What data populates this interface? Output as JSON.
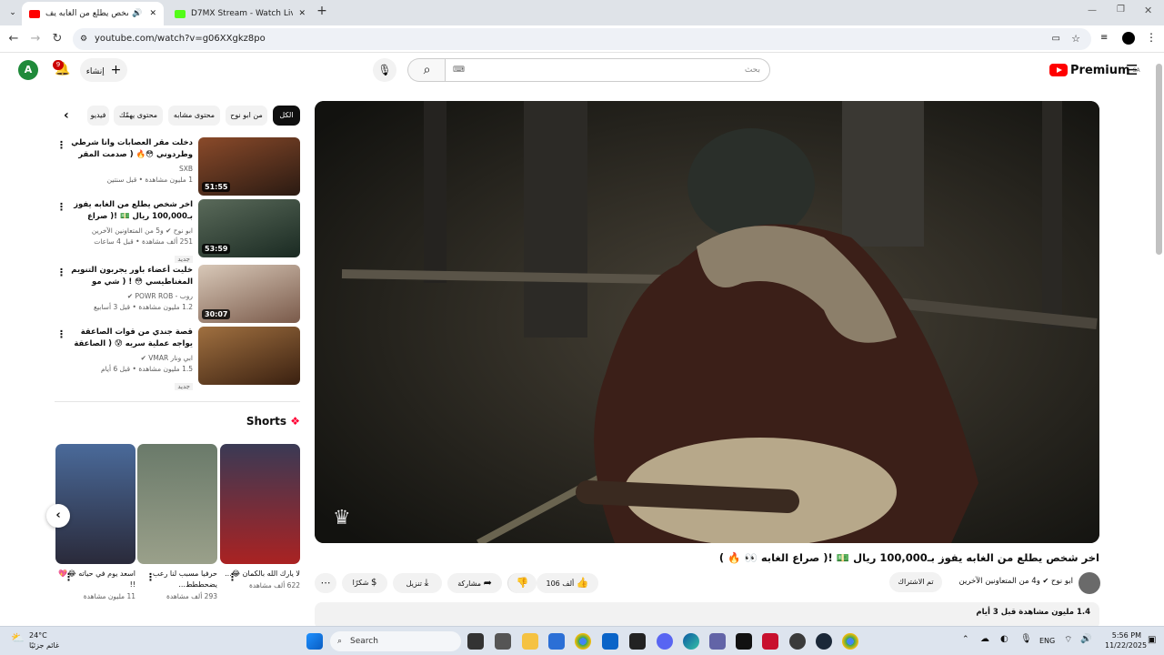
{
  "browser": {
    "tabs": [
      {
        "title": "اخر شخص يطلع من الغابه يف",
        "active": true,
        "favicon_color": "#ff0000"
      },
      {
        "title": "D7MX Stream - Watch Live on",
        "active": false,
        "favicon_color": "#53fc18"
      }
    ],
    "url": "youtube.com/watch?v=g06XXgkz8po",
    "new_tab": "+"
  },
  "yt": {
    "avatar_letter": "A",
    "notif_count": "9",
    "create_label": "إنشاء",
    "search_placeholder": "بحث",
    "logo_text": "Premium",
    "logo_region": "SA"
  },
  "chips": [
    "الكل",
    "من ابو نوح",
    "محتوى مشابه",
    "محتوى يهمّك",
    "فيديو"
  ],
  "related": [
    {
      "title": "دخلت مقر العصابات وانا شرطي وطردوني 😳🔥 ( صدمت المقر 😡)!",
      "channel": "SXB",
      "views": "1 مليون مشاهدة • قبل سنتين",
      "badge": "",
      "duration": "51:55",
      "thumb_bg": "#5a3322"
    },
    {
      "title": "اخر شخص يطلع من الغابه يفوز بـ100,000 ريال 💵 !( صراع الغابه 👀...",
      "channel": "ابو نوح ✔ و5 من المتعاونين الآخرين",
      "views": "251 ألف مشاهدة • قبل 4 ساعات",
      "badge": "جديد",
      "duration": "53:59",
      "thumb_bg": "#3a4a3a"
    },
    {
      "title": "خليت أعضاء باور يجربون التنويم المغناطيسي 😳 ! ( شي مو طبيعي)!!",
      "channel": "روب - POWR ROB ✔",
      "views": "1.2 مليون مشاهدة • قبل 3 أسابيع",
      "badge": "",
      "duration": "30:07",
      "thumb_bg": "#b0a090"
    },
    {
      "title": "قصة جندي من قوات الصاعقة يواجه عملية سريه 😰 ( الصاعقة الحربية ) !",
      "channel": "ابي ونار VMAR ✔",
      "views": "1.5 مليون مشاهدة • قبل 6 أيام",
      "badge": "جديد",
      "duration": "",
      "thumb_bg": "#6a4a2a"
    }
  ],
  "shorts": {
    "heading": "Shorts",
    "items": [
      {
        "title": "لا يارك الله بالكمان 😂...",
        "views": "622 ألف مشاهدة",
        "bg": "#3a3a55"
      },
      {
        "title": "حرفيا مسبب لنا رعب يضحططط...",
        "views": "293 ألف مشاهدة",
        "bg": "#7a8a6a"
      },
      {
        "title": "اسعد يوم في حياته 😂💖 !!",
        "views": "11 مليون مشاهدة",
        "bg": "#2a3a55"
      }
    ]
  },
  "video": {
    "title": "اخر شخص يطلع من الغابه يفوز بـ100,000 ريال 💵 !( صراع الغابه 👀 🔥 )",
    "channel": "ابو نوح",
    "collab": "و4 من المتعاونين الآخرين",
    "subscribe_label": "تم الاشتراك",
    "likes": "106 ألف",
    "share": "مشاركة",
    "download": "تنزيل",
    "thanks": "شكرًا",
    "description_views": "1.4 مليون مشاهدة  قبل 3 أيام"
  },
  "taskbar": {
    "weather_temp": "24°C",
    "weather_desc": "غائم جزئيًا",
    "search_label": "Search",
    "lang": "ENG",
    "time": "5:56 PM",
    "date": "11/22/2025"
  }
}
